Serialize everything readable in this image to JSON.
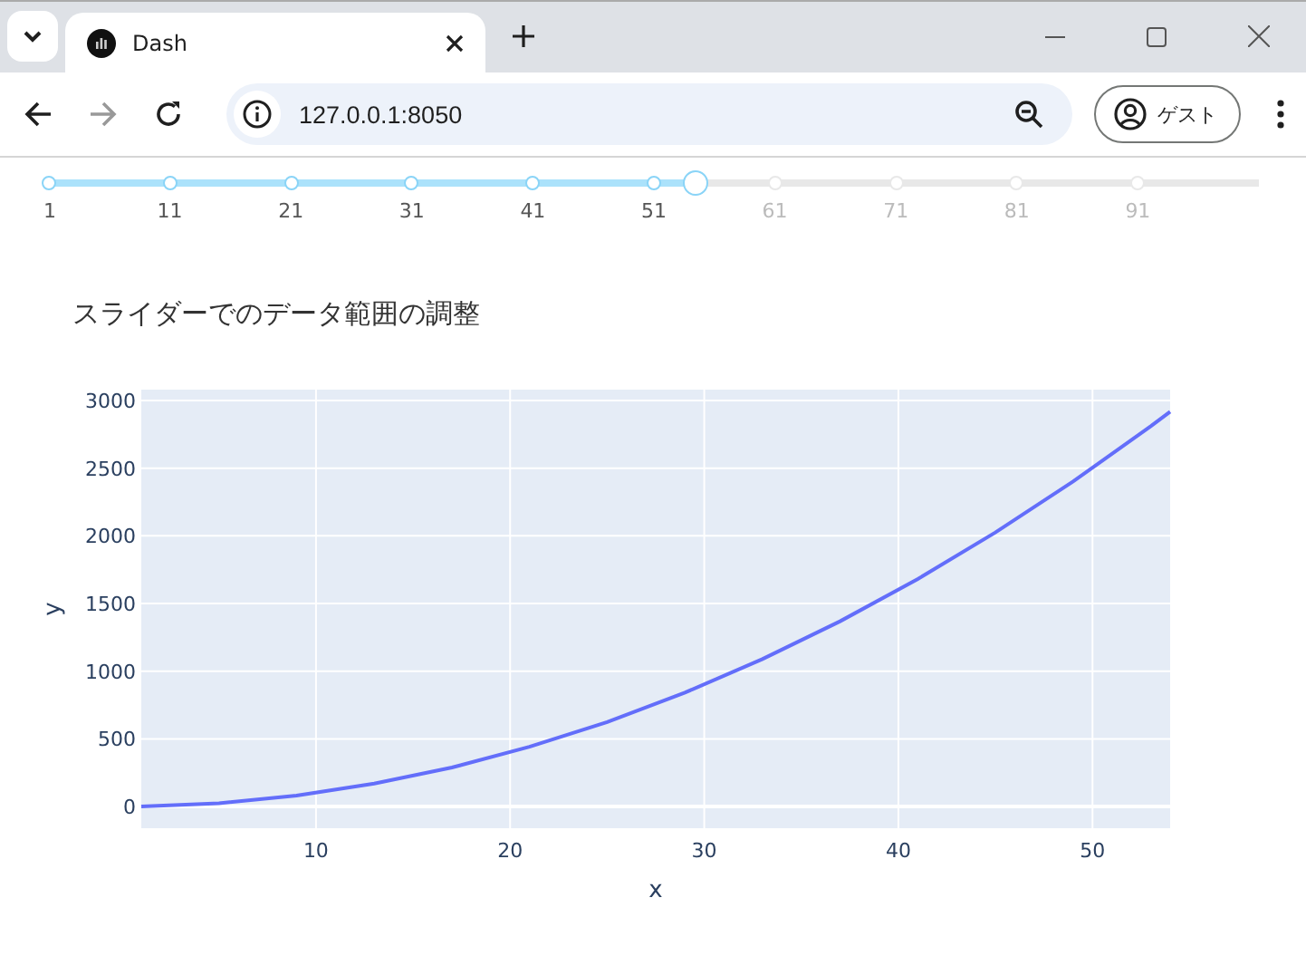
{
  "browser": {
    "tab_title": "Dash",
    "address": "127.0.0.1:8050",
    "profile": "ゲスト"
  },
  "slider": {
    "level": 0.535,
    "marks": [
      {
        "label": "1",
        "included": true
      },
      {
        "label": "11",
        "included": true
      },
      {
        "label": "21",
        "included": true
      },
      {
        "label": "31",
        "included": true
      },
      {
        "label": "41",
        "included": true
      },
      {
        "label": "51",
        "included": true
      },
      {
        "label": "61",
        "included": false
      },
      {
        "label": "71",
        "included": false
      },
      {
        "label": "81",
        "included": false
      },
      {
        "label": "91",
        "included": false
      }
    ]
  },
  "heading": "スライダーでのデータ範囲の調整",
  "chart": {
    "chart_data": {
      "type": "line",
      "grid": true,
      "xlabel": "x",
      "ylabel": "y",
      "xlim": [
        1,
        54
      ],
      "ylim": [
        -160,
        3080
      ],
      "xticks": [
        10,
        20,
        30,
        40,
        50
      ],
      "yticks": [
        0,
        500,
        1000,
        1500,
        2000,
        2500,
        3000
      ],
      "x": [
        1,
        5,
        9,
        13,
        17,
        21,
        25,
        29,
        33,
        37,
        41,
        45,
        49,
        53,
        54
      ],
      "series": [
        {
          "color": "#636efa",
          "values": [
            1,
            25,
            81,
            169,
            289,
            441,
            625,
            841,
            1089,
            1369,
            1681,
            2025,
            2401,
            2809,
            2916
          ]
        }
      ]
    }
  }
}
